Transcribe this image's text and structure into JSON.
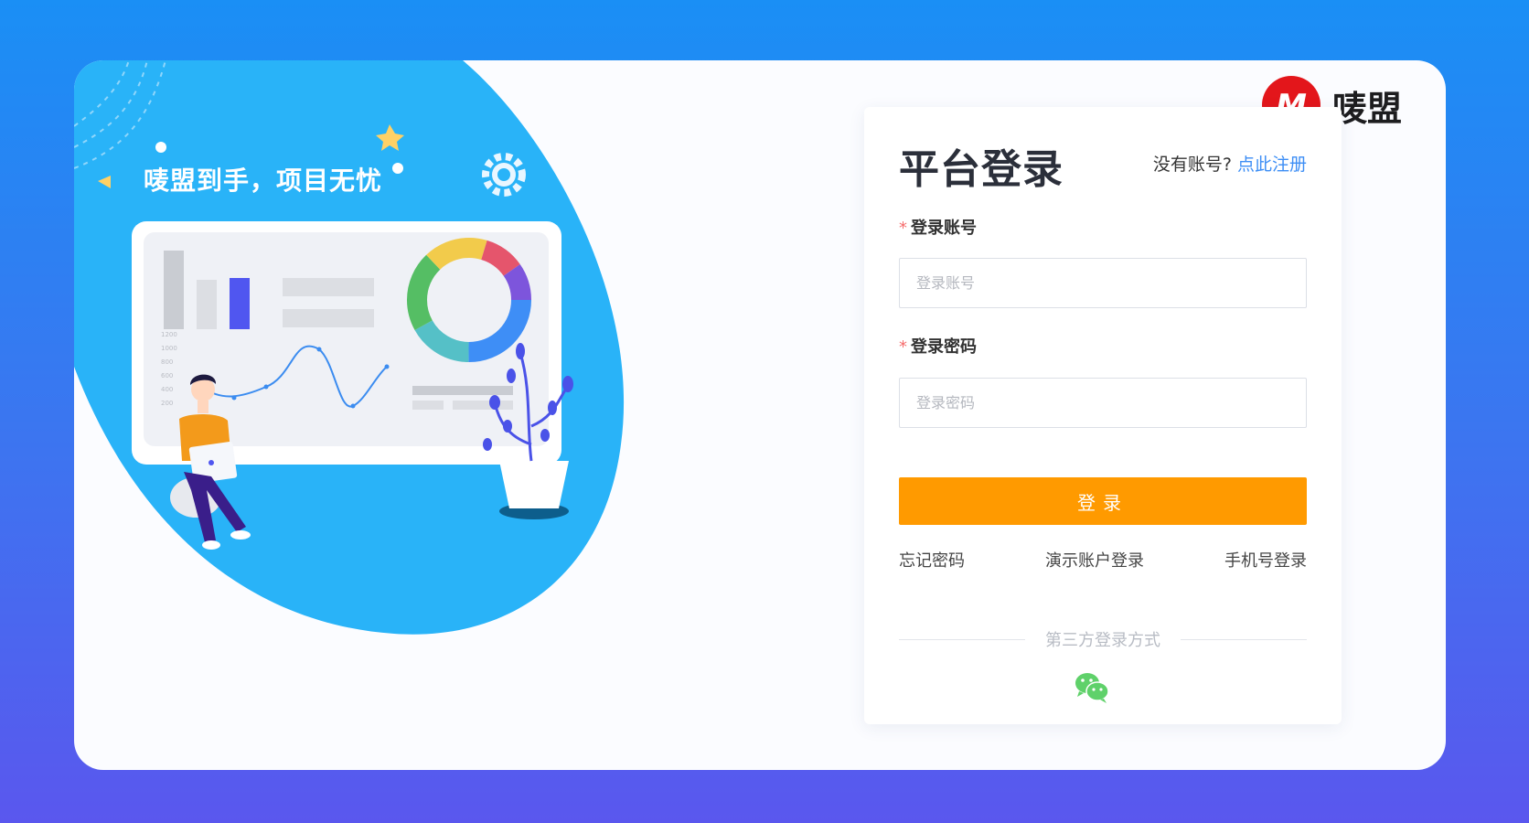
{
  "brand": {
    "name": "唛盟",
    "logo_letter": "M",
    "logo_color": "#e3161b"
  },
  "hero": {
    "slogan": "唛盟到手，项目无忧",
    "accent_color": "#29b3f8"
  },
  "login": {
    "title": "平台登录",
    "register_hint": "没有账号?",
    "register_link": "点此注册",
    "account_label": "登录账号",
    "account_placeholder": "登录账号",
    "account_value": "",
    "password_label": "登录密码",
    "password_placeholder": "登录密码",
    "password_value": "",
    "required_mark": "*",
    "submit_label": "登录",
    "forgot_password": "忘记密码",
    "demo_login": "演示账户登录",
    "phone_login": "手机号登录",
    "third_party_label": "第三方登录方式",
    "third_party_icons": [
      "wechat-icon"
    ],
    "button_color": "#ff9a00",
    "link_color": "#3d8ef5"
  }
}
